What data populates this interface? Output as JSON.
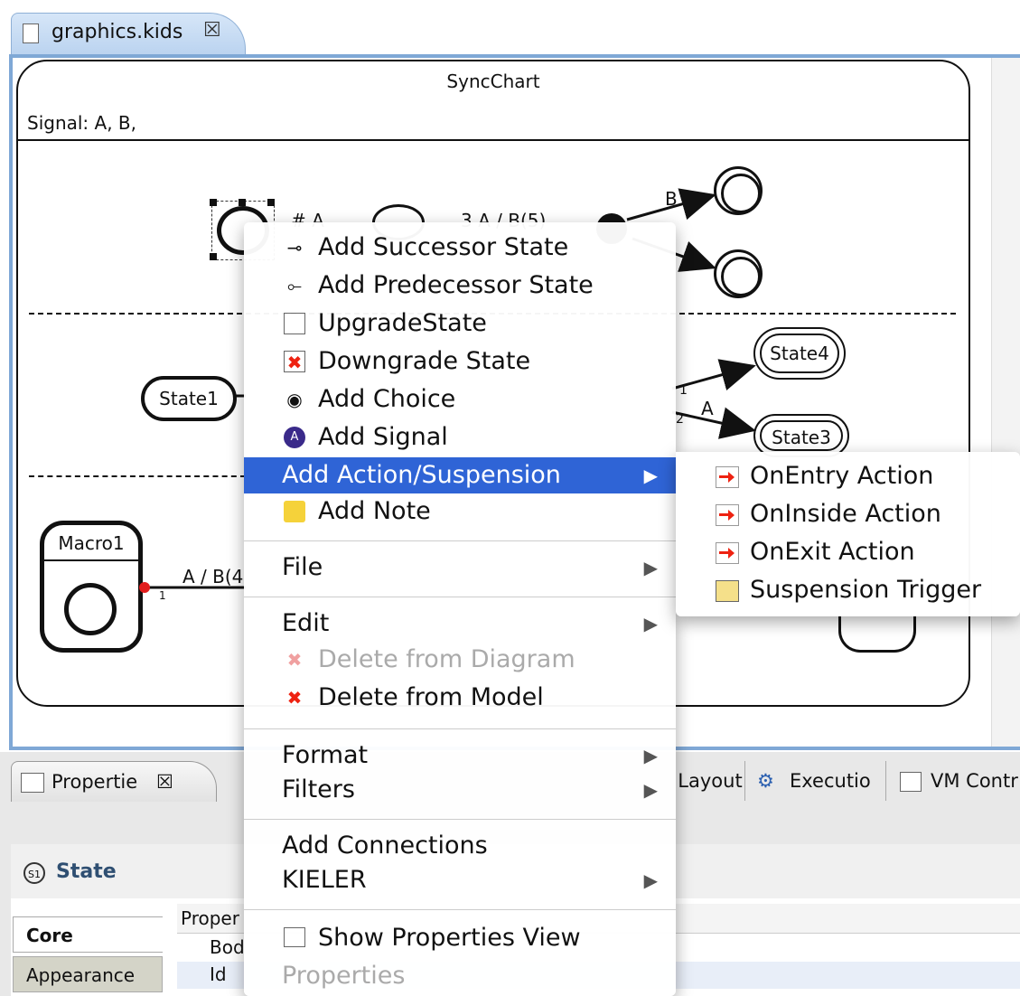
{
  "editor": {
    "tab_label": "graphics.kids",
    "close_glyph": "☒"
  },
  "diagram": {
    "title": "SyncChart",
    "signals": "Signal: A, B,",
    "labels": {
      "hash_a": "# A",
      "three_a_b5": "3 A / B(5)",
      "b": "B",
      "state4": "State4",
      "state3": "State3",
      "state1": "State1",
      "a": "A",
      "one_a": "1",
      "two_a": "2",
      "macro1": "Macro1",
      "a_b4": "A / B(4",
      "one_b": "1"
    }
  },
  "context_menu": {
    "items": [
      {
        "label": "Add Successor State",
        "icon": "successor-icon"
      },
      {
        "label": "Add Predecessor State",
        "icon": "predecessor-icon"
      },
      {
        "label": "UpgradeState",
        "icon": "upgrade-icon"
      },
      {
        "label": "Downgrade State",
        "icon": "downgrade-icon"
      },
      {
        "label": "Add Choice",
        "icon": "choice-icon"
      },
      {
        "label": "Add Signal",
        "icon": "signal-icon"
      },
      {
        "label": "Add Action/Suspension",
        "icon": "",
        "submenu": true,
        "highlighted": true
      },
      {
        "label": "Add Note",
        "icon": "note-icon"
      },
      {
        "label": "File",
        "submenu": true
      },
      {
        "label": "Edit",
        "submenu": true
      },
      {
        "label": "Delete from Diagram",
        "icon": "delete-icon",
        "disabled": true
      },
      {
        "label": "Delete from Model",
        "icon": "delete-icon"
      },
      {
        "label": "Format",
        "submenu": true
      },
      {
        "label": "Filters",
        "submenu": true
      },
      {
        "label": "Add Connections"
      },
      {
        "label": "KIELER",
        "submenu": true
      },
      {
        "label": "Show Properties View",
        "icon": "properties-icon"
      },
      {
        "label": "Properties",
        "disabled": true
      }
    ],
    "submenu_arrow": "▶"
  },
  "submenu": {
    "items": [
      {
        "label": "OnEntry Action",
        "icon": "entry-action-icon"
      },
      {
        "label": "OnInside Action",
        "icon": "inside-action-icon"
      },
      {
        "label": "OnExit Action",
        "icon": "exit-action-icon"
      },
      {
        "label": "Suspension Trigger",
        "icon": "suspension-icon"
      }
    ]
  },
  "bottom": {
    "tabs": {
      "properties": "Propertie",
      "layout": "Layout",
      "execution": "Executio",
      "vm_control": "VM Contr"
    },
    "section_title": "State",
    "section_badge": "S1",
    "side_tabs": {
      "core": "Core",
      "appearance": "Appearance"
    },
    "table": {
      "column_property": "Proper",
      "rows": [
        "Bod",
        "Id"
      ]
    }
  },
  "colors": {
    "menu_highlight": "#2f64d6",
    "editor_frame": "#7fa8d6",
    "red_handle": "#e21d1d"
  }
}
